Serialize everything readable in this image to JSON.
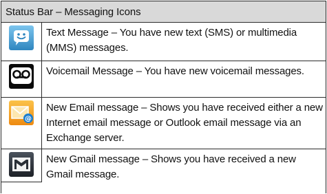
{
  "table": {
    "header": "Status Bar – Messaging Icons",
    "rows": [
      {
        "icon": "text-message-icon",
        "text": "Text Message – You have new text (SMS) or multimedia (MMS) messages."
      },
      {
        "icon": "voicemail-icon",
        "text": "Voicemail Message – You have new voicemail messages."
      },
      {
        "icon": "email-icon",
        "text": "New Email message – Shows you have received either a new Internet email message or Outlook email message via an Exchange server."
      },
      {
        "icon": "gmail-icon",
        "text": "New Gmail message – Shows you have received a new Gmail message."
      }
    ]
  },
  "colors": {
    "header_bg": "#d9d9d9",
    "text_message_icon": "#4a9fd0",
    "voicemail_icon": "#0a0a0a",
    "email_icon": "#f39a1a",
    "gmail_icon": "#2a2f36"
  }
}
